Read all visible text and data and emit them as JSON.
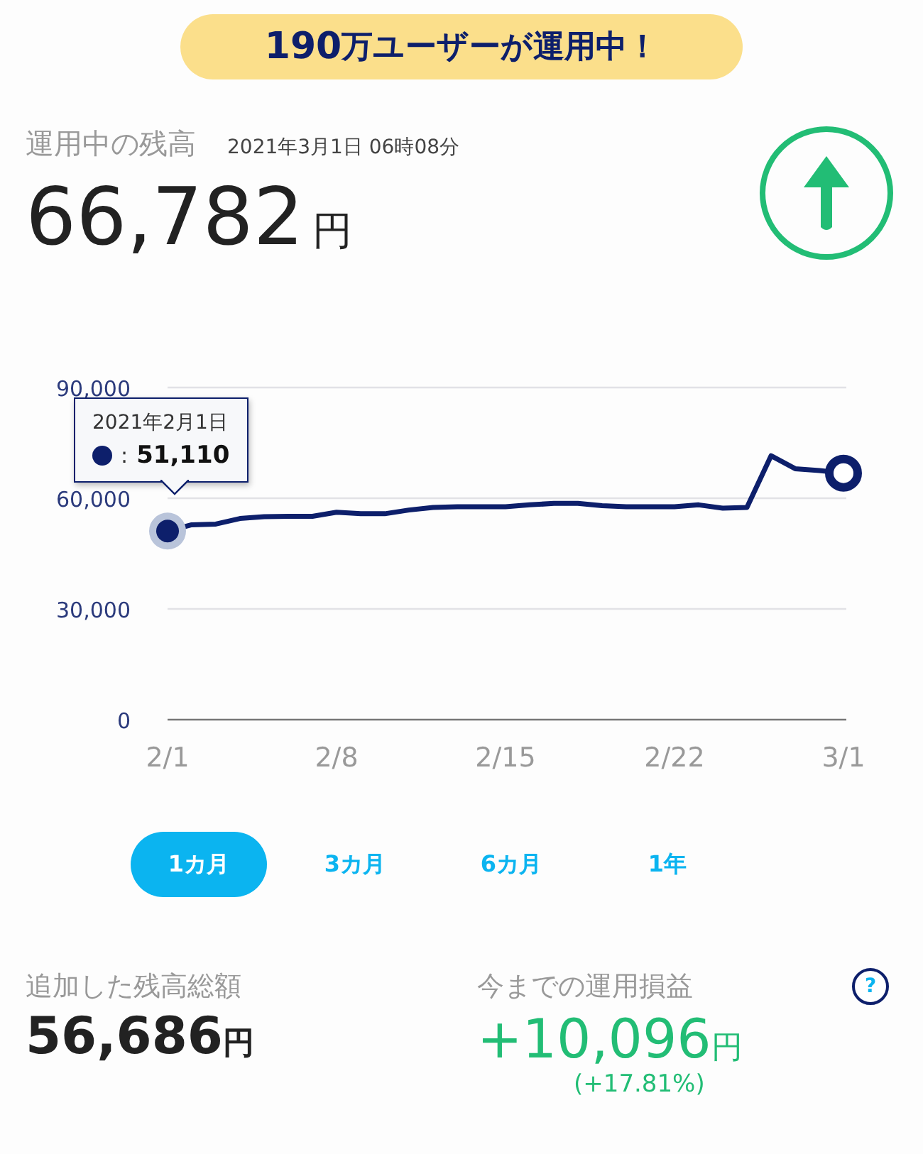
{
  "banner": {
    "count": "190",
    "text": "万ユーザーが運用中！"
  },
  "balance": {
    "label": "運用中の残高",
    "timestamp": "2021年3月1日 06時08分",
    "amount": "66,782",
    "unit": "円"
  },
  "chart": {
    "tooltip": {
      "date": "2021年2月1日",
      "separator": ":",
      "value": "51,110"
    },
    "chart_data": {
      "type": "line",
      "categories": [
        "2/1",
        null,
        null,
        null,
        null,
        null,
        null,
        "2/8",
        null,
        null,
        null,
        null,
        null,
        null,
        "2/15",
        null,
        null,
        null,
        null,
        null,
        null,
        "2/22",
        null,
        null,
        null,
        null,
        null,
        null,
        "3/1"
      ],
      "series": [
        {
          "color": "#0d1f6b",
          "values": [
            51100,
            52800,
            53000,
            54500,
            55000,
            55100,
            55100,
            56200,
            55800,
            55800,
            56800,
            57500,
            57700,
            57700,
            57700,
            58200,
            58600,
            58600,
            58000,
            57700,
            57700,
            57700,
            58200,
            57300,
            57500,
            71500,
            68000,
            67500,
            66800
          ]
        }
      ],
      "ylim": [
        0,
        90000
      ],
      "yticks": [
        {
          "value": 90000,
          "label": "90,000"
        },
        {
          "value": 60000,
          "label": "60,000"
        },
        {
          "value": 30000,
          "label": "30,000"
        },
        {
          "value": 0,
          "label": "0"
        }
      ]
    }
  },
  "periods": [
    {
      "label": "1カ月",
      "selected": true
    },
    {
      "label": "3カ月",
      "selected": false
    },
    {
      "label": "6カ月",
      "selected": false
    },
    {
      "label": "1年",
      "selected": false
    }
  ],
  "added": {
    "label": "追加した残高総額",
    "amount": "56,686",
    "unit": "円"
  },
  "profit": {
    "label": "今までの運用損益",
    "amount": "+10,096",
    "unit": "円",
    "percent": "(+17.81%)",
    "help": "?"
  }
}
